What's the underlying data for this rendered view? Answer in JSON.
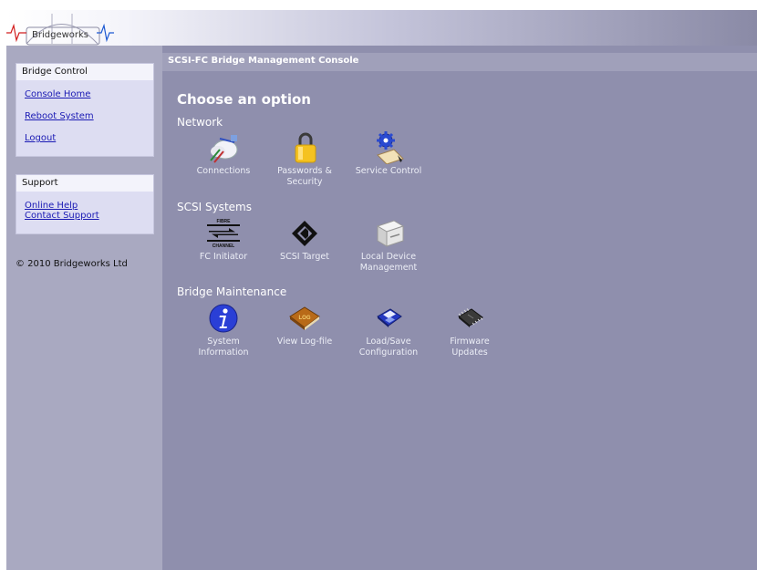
{
  "header": {
    "logo_text": "Bridgeworks"
  },
  "console_title": "SCSI-FC Bridge Management Console",
  "sidebar": {
    "bridge_control": {
      "title": "Bridge Control",
      "links": [
        "Console Home",
        "Reboot System",
        "Logout"
      ]
    },
    "support": {
      "title": "Support",
      "links": [
        "Online Help",
        "Contact Support"
      ]
    },
    "copyright": "© 2010 Bridgeworks Ltd"
  },
  "main": {
    "heading": "Choose an option",
    "sections": [
      {
        "title": "Network",
        "items": [
          {
            "label": "Connections",
            "icon": "connections-icon"
          },
          {
            "label": "Passwords &\nSecurity",
            "icon": "padlock-icon"
          },
          {
            "label": "Service Control",
            "icon": "service-control-icon"
          }
        ]
      },
      {
        "title": "SCSI Systems",
        "items": [
          {
            "label": "FC Initiator",
            "icon": "fibre-channel-icon"
          },
          {
            "label": "SCSI Target",
            "icon": "scsi-target-icon"
          },
          {
            "label": "Local Device\nManagement",
            "icon": "local-device-icon"
          }
        ]
      },
      {
        "title": "Bridge Maintenance",
        "items": [
          {
            "label": "System\nInformation",
            "icon": "info-icon"
          },
          {
            "label": "View Log-file",
            "icon": "log-book-icon"
          },
          {
            "label": "Load/Save\nConfiguration",
            "icon": "floppy-disk-icon"
          },
          {
            "label": "Firmware\nUpdates",
            "icon": "chip-icon"
          }
        ]
      }
    ]
  },
  "icon_text": {
    "log": "LOG",
    "fibre": "FIBRE",
    "channel": "CHANNEL"
  },
  "colors": {
    "sidebar": "#a9a9c1",
    "main": "#8f8fad",
    "link": "#1a1ab4",
    "info_blue": "#2a3fd6",
    "log_book": "#b86a18"
  }
}
